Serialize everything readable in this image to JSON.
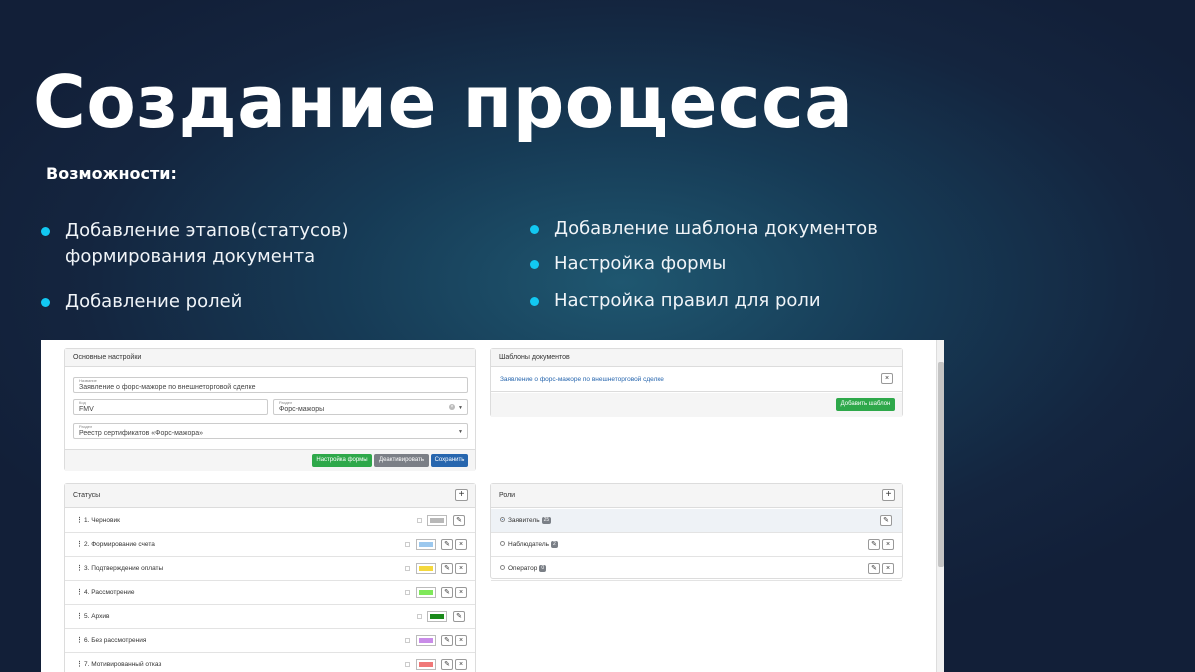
{
  "slide": {
    "title": "Создание процесса",
    "subtitle": "Возможности:",
    "bullets_left": [
      "Добавление этапов(статусов)\nформирования документа",
      "Добавление ролей"
    ],
    "bullets_right": [
      "Добавление шаблона документов",
      "Настройка формы",
      "Настройка правил для роли"
    ],
    "accent_color": "#12c8f2"
  },
  "main_settings": {
    "header": "Основные настройки",
    "name": {
      "label": "Название",
      "value": "Заявление о форс-мажоре по внешнеторговой сделке"
    },
    "code": {
      "label": "Код",
      "value": "FMV"
    },
    "section": {
      "label": "Раздел",
      "value": "Форс-мажоры"
    },
    "registry": {
      "label": "Раздел",
      "value": "Реестр сертификатов «Форс-мажора»"
    },
    "buttons": {
      "form_settings": "Настройка формы",
      "deactivate": "Деактивировать",
      "save": "Сохранить"
    }
  },
  "templates": {
    "header": "Шаблоны документов",
    "items": [
      "Заявление о форс-мажоре по внешнеторговой сделке"
    ],
    "add_button": "Добавить шаблон"
  },
  "statuses": {
    "header": "Статусы",
    "items": [
      {
        "label": "1. Черновик",
        "color": "#b8b8b8",
        "deletable": false
      },
      {
        "label": "2. Формирование счета",
        "color": "#9cc8ee",
        "deletable": true
      },
      {
        "label": "3. Подтверждение оплаты",
        "color": "#f4d83e",
        "deletable": true
      },
      {
        "label": "4. Рассмотрение",
        "color": "#7fe85a",
        "deletable": true
      },
      {
        "label": "5. Архив",
        "color": "#1a8a1a",
        "deletable": false
      },
      {
        "label": "6. Без рассмотрения",
        "color": "#c98ce8",
        "deletable": true
      },
      {
        "label": "7. Мотивированный отказ",
        "color": "#f07878",
        "deletable": true
      }
    ]
  },
  "roles": {
    "header": "Роли",
    "items": [
      {
        "label": "Заявитель",
        "count": "25",
        "selected": true,
        "deletable": false
      },
      {
        "label": "Наблюдатель",
        "count": "2",
        "selected": false,
        "deletable": true
      },
      {
        "label": "Оператор",
        "count": "0",
        "selected": false,
        "deletable": true
      }
    ]
  }
}
